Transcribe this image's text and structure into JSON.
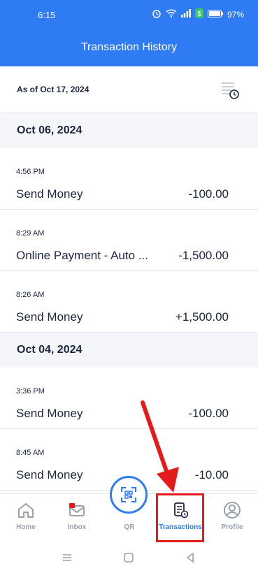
{
  "status_bar": {
    "time": "6:15",
    "battery_percent": "97%"
  },
  "header": {
    "title": "Transaction History"
  },
  "as_of": {
    "label": "As of Oct 17, 2024"
  },
  "groups": [
    {
      "date": "Oct 06, 2024",
      "transactions": [
        {
          "time": "4:56 PM",
          "name": "Send Money",
          "amount": "-100.00"
        },
        {
          "time": "8:29 AM",
          "name": "Online Payment - Auto ...",
          "amount": "-1,500.00"
        },
        {
          "time": "8:26 AM",
          "name": "Send Money",
          "amount": "+1,500.00"
        }
      ]
    },
    {
      "date": "Oct 04, 2024",
      "transactions": [
        {
          "time": "3:36 PM",
          "name": "Send Money",
          "amount": "-100.00"
        },
        {
          "time": "8:45 AM",
          "name": "Send Money",
          "amount": "-10.00"
        }
      ]
    }
  ],
  "bottom_nav": {
    "home": "Home",
    "inbox": "Inbox",
    "qr": "QR",
    "transactions": "Transactions",
    "profile": "Profile",
    "active": "transactions"
  },
  "colors": {
    "primary": "#2f7bf3",
    "highlight": "#e51b1b",
    "inbox_badge": "#e51b1b",
    "text_dark": "#1c2640",
    "text_muted": "#9aa1ac"
  },
  "icons": {
    "status": [
      "alarm-icon",
      "wifi-icon",
      "signal-icon",
      "app-badge-icon",
      "battery-icon"
    ],
    "filter": "history-filter-icon",
    "nav": [
      "home-icon",
      "inbox-icon",
      "qr-icon",
      "transactions-icon",
      "profile-icon"
    ],
    "system": [
      "menu-icon",
      "home-square-icon",
      "back-icon"
    ]
  }
}
